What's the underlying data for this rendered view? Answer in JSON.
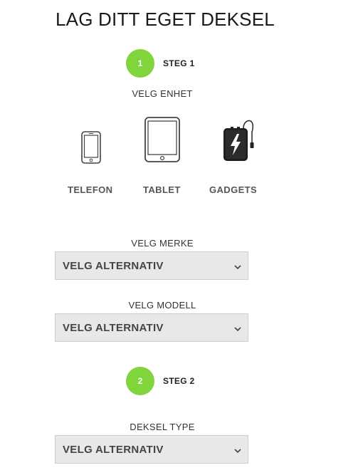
{
  "page": {
    "title": "LAG DITT EGET DEKSEL"
  },
  "colors": {
    "accent": "#82d43c",
    "select_bg": "#e8e8e8"
  },
  "steps": [
    {
      "number": "1",
      "label": "STEG 1"
    },
    {
      "number": "2",
      "label": "STEG 2"
    }
  ],
  "device_section": {
    "label": "VELG ENHET",
    "devices": [
      {
        "label": "TELEFON",
        "icon": "phone-icon"
      },
      {
        "label": "TABLET",
        "icon": "tablet-icon"
      },
      {
        "label": "GADGETS",
        "icon": "powerbank-icon"
      }
    ]
  },
  "brand_select": {
    "label": "VELG MERKE",
    "value": "VELG ALTERNATIV"
  },
  "model_select": {
    "label": "VELG MODELL",
    "value": "VELG ALTERNATIV"
  },
  "case_type_select": {
    "label": "DEKSEL TYPE",
    "value": "VELG ALTERNATIV"
  }
}
